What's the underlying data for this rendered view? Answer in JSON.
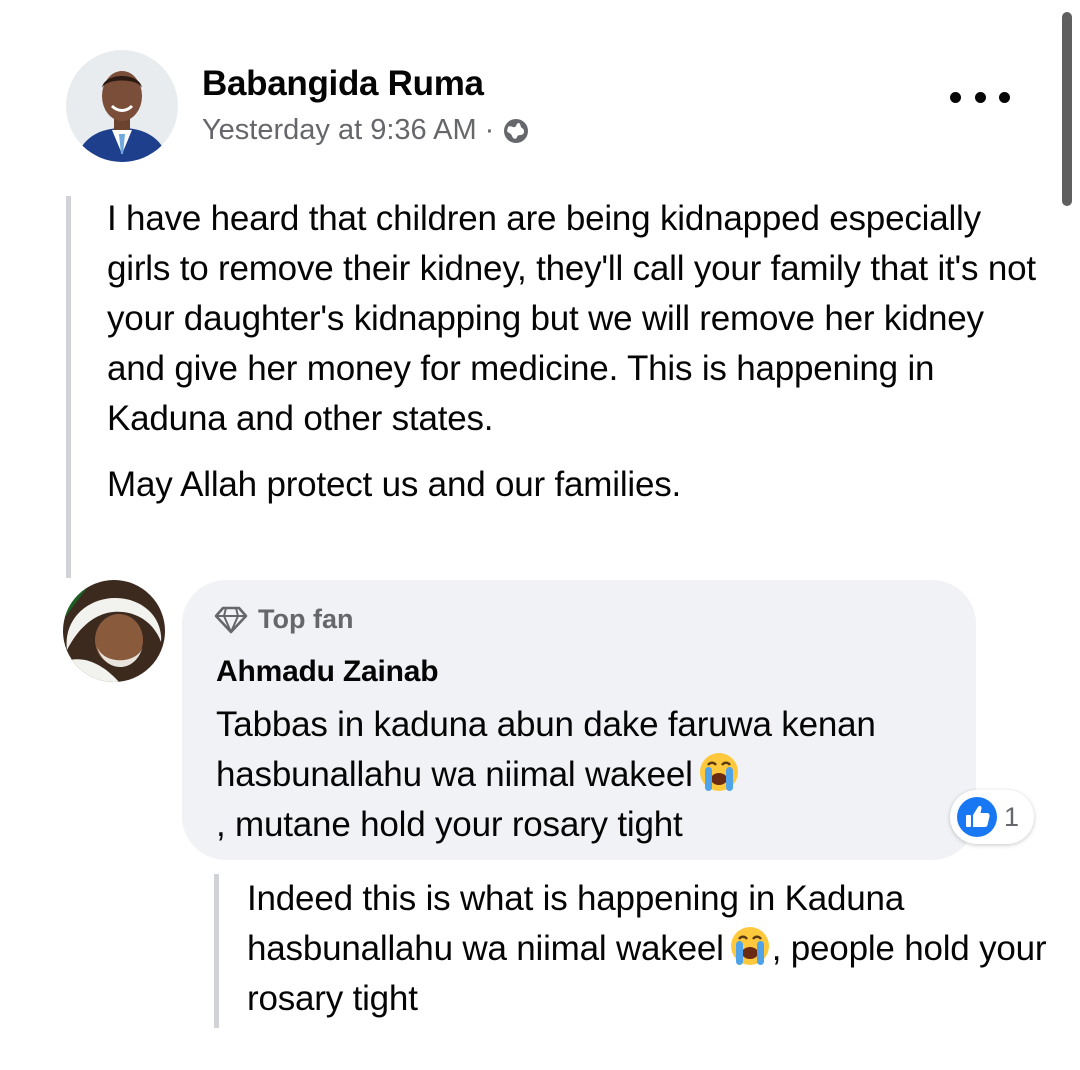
{
  "post": {
    "author": "Babangida Ruma",
    "timestamp": "Yesterday at 9:36 AM",
    "separator": "·",
    "privacy_icon": "globe-icon",
    "more_icon": "more-horizontal-icon",
    "body_paragraph_1": "I have heard that children are being kidnapped especially girls to remove their kidney, they'll call your family that it's not your daughter's kidnapping but we will remove her kidney and give her money for medicine. This is happening in Kaduna and other states.",
    "body_paragraph_2": "May Allah protect us and our families."
  },
  "comment": {
    "badge_icon": "diamond-icon",
    "badge_label": "Top fan",
    "author": "Ahmadu Zainab",
    "text_part_1": "Tabbas in kaduna abun dake faruwa kenan hasbunallahu wa niimal wakeel",
    "text_part_2": ", mutane hold your rosary tight",
    "emoji": "loudly-crying-face",
    "reaction_icon": "like-icon",
    "reaction_count": "1"
  },
  "translation": {
    "text_part_1": "Indeed this is what is happening in Kaduna hasbunallahu wa niimal wakeel",
    "text_part_2": ", people hold your rosary tight",
    "emoji": "loudly-crying-face"
  },
  "colors": {
    "text_primary": "#050505",
    "text_secondary": "#65676b",
    "bubble_background": "#f0f2f5",
    "like_blue": "#1877f2",
    "quote_bar": "#d2d3d7"
  }
}
